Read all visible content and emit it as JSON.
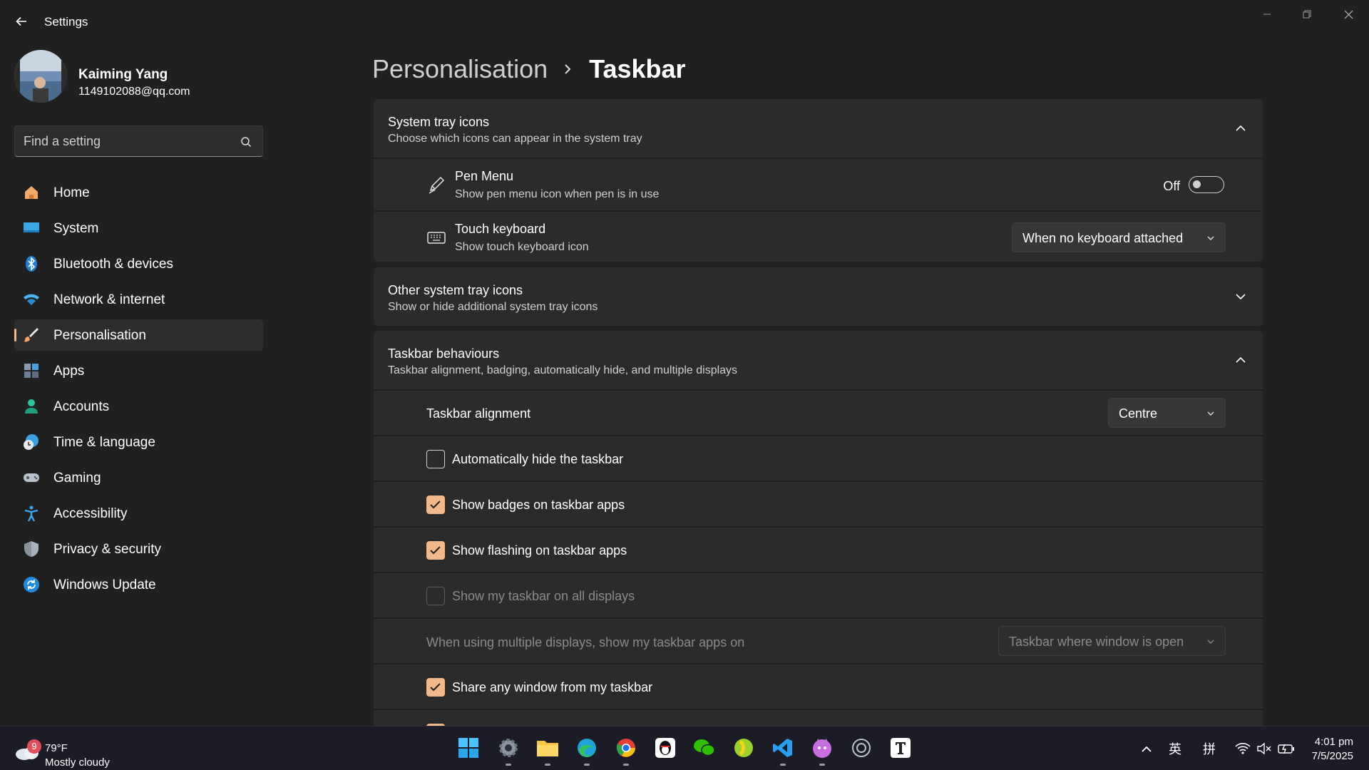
{
  "window": {
    "title": "Settings"
  },
  "user": {
    "name": "Kaiming Yang",
    "email": "1149102088@qq.com"
  },
  "search": {
    "placeholder": "Find a setting"
  },
  "nav": [
    {
      "label": "Home",
      "icon": "home-icon"
    },
    {
      "label": "System",
      "icon": "system-icon"
    },
    {
      "label": "Bluetooth & devices",
      "icon": "bluetooth-icon"
    },
    {
      "label": "Network & internet",
      "icon": "wifi-icon"
    },
    {
      "label": "Personalisation",
      "icon": "brush-icon",
      "active": true
    },
    {
      "label": "Apps",
      "icon": "apps-icon"
    },
    {
      "label": "Accounts",
      "icon": "accounts-icon"
    },
    {
      "label": "Time & language",
      "icon": "clock-globe-icon"
    },
    {
      "label": "Gaming",
      "icon": "gamepad-icon"
    },
    {
      "label": "Accessibility",
      "icon": "accessibility-icon"
    },
    {
      "label": "Privacy & security",
      "icon": "shield-icon"
    },
    {
      "label": "Windows Update",
      "icon": "update-icon"
    }
  ],
  "breadcrumb": {
    "parent": "Personalisation",
    "current": "Taskbar"
  },
  "system_tray": {
    "title": "System tray icons",
    "subtitle": "Choose which icons can appear in the system tray",
    "pen_menu": {
      "title": "Pen Menu",
      "subtitle": "Show pen menu icon when pen is in use",
      "state_label": "Off"
    },
    "touch_keyboard": {
      "title": "Touch keyboard",
      "subtitle": "Show touch keyboard icon",
      "value": "When no keyboard attached"
    }
  },
  "other_tray": {
    "title": "Other system tray icons",
    "subtitle": "Show or hide additional system tray icons"
  },
  "behaviours": {
    "title": "Taskbar behaviours",
    "subtitle": "Taskbar alignment, badging, automatically hide, and multiple displays",
    "alignment": {
      "label": "Taskbar alignment",
      "value": "Centre"
    },
    "auto_hide": {
      "label": "Automatically hide the taskbar",
      "checked": false
    },
    "badges": {
      "label": "Show badges on taskbar apps",
      "checked": true
    },
    "flashing": {
      "label": "Show flashing on taskbar apps",
      "checked": true
    },
    "all_displays": {
      "label": "Show my taskbar on all displays",
      "checked": false,
      "disabled": true
    },
    "multi_display": {
      "label": "When using multiple displays, show my taskbar apps on",
      "value": "Taskbar where window is open",
      "disabled": true
    },
    "share_window": {
      "label": "Share any window from my taskbar",
      "checked": true
    }
  },
  "taskbar": {
    "weather": {
      "temp": "79°F",
      "desc": "Mostly cloudy",
      "badge": "9"
    },
    "ime_1": "英",
    "ime_2": "拼",
    "time": "4:01 pm",
    "date": "7/5/2025"
  },
  "colors": {
    "accent": "#f3b88a",
    "background": "#202020",
    "card": "#2b2b2b"
  }
}
